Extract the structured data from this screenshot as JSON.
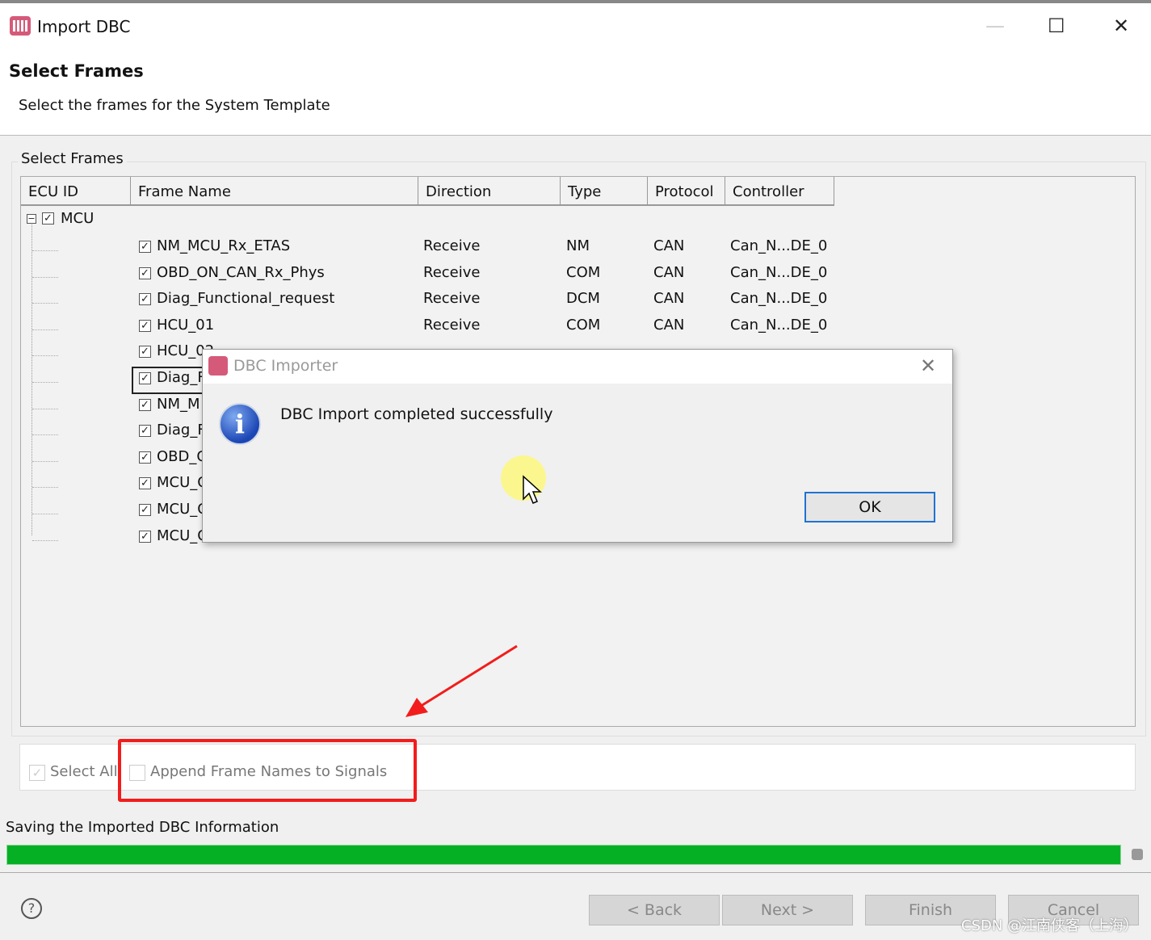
{
  "window": {
    "title": "Import DBC",
    "minimize": "—",
    "maximize": "☐",
    "close": "✕"
  },
  "header": {
    "title": "Select Frames",
    "subtitle": "Select the frames for the System Template"
  },
  "group": {
    "label": "Select Frames"
  },
  "table": {
    "columns": [
      "ECU ID",
      "Frame Name",
      "Direction",
      "Type",
      "Protocol",
      "Controller"
    ],
    "ecu": "MCU",
    "rows": [
      {
        "name": "NM_MCU_Rx_ETAS",
        "direction": "Receive",
        "type": "NM",
        "protocol": "CAN",
        "controller": "Can_N...DE_0"
      },
      {
        "name": "OBD_ON_CAN_Rx_Phys",
        "direction": "Receive",
        "type": "COM",
        "protocol": "CAN",
        "controller": "Can_N...DE_0"
      },
      {
        "name": "Diag_Functional_request",
        "direction": "Receive",
        "type": "DCM",
        "protocol": "CAN",
        "controller": "Can_N...DE_0"
      },
      {
        "name": "HCU_01",
        "direction": "Receive",
        "type": "COM",
        "protocol": "CAN",
        "controller": "Can_N...DE_0"
      },
      {
        "name": "HCU_02"
      },
      {
        "name": "Diag_F"
      },
      {
        "name": "NM_M"
      },
      {
        "name": "Diag_F"
      },
      {
        "name": "OBD_C"
      },
      {
        "name": "MCU_C"
      },
      {
        "name": "MCU_C"
      },
      {
        "name": "MCU_C"
      }
    ]
  },
  "options": {
    "select_all": "Select All",
    "append": "Append Frame Names to Signals",
    "select_all_checked": true,
    "append_checked": false
  },
  "status": {
    "text": "Saving the Imported DBC Information",
    "progress_percent": 100,
    "color": "#06b025"
  },
  "buttons": {
    "back": "< Back",
    "next": "Next >",
    "finish": "Finish",
    "cancel": "Cancel",
    "help": "?"
  },
  "dialog": {
    "title": "DBC Importer",
    "message": "DBC Import completed successfully",
    "ok": "OK",
    "close": "✕",
    "icon": "info-icon"
  },
  "watermark": "CSDN @江南侠客（上海）",
  "annotation": {
    "color": "#f21c1c"
  }
}
